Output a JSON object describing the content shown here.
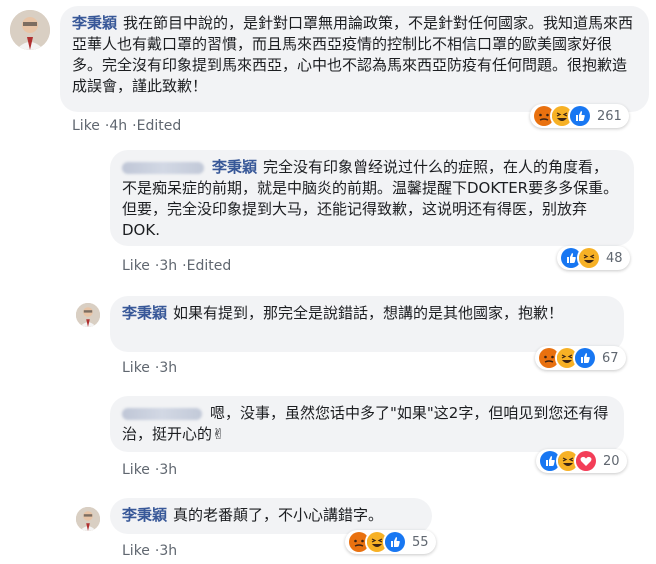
{
  "comments": [
    {
      "author": "李秉穎",
      "text": "我在節目中說的，是針對口罩無用論政策，不是針對任何國家。我知道馬來西亞華人也有戴口罩的習慣，而且馬來西亞疫情的控制比不相信口罩的歐美國家好很多。完全沒有印象提到馬來西亞，心中也不認為馬來西亞防疫有任何問題。很抱歉造成誤會，謹此致歉！",
      "like": "Like",
      "time": "4h",
      "edited": "Edited",
      "reactions": [
        "angry-icon",
        "haha-icon",
        "like-icon"
      ],
      "count": "261"
    },
    {
      "author": "李秉穎",
      "text": "完全没有印象曾经说过什么的症照，在人的角度看，不是痴呆症的前期，就是中脑炎的前期。温馨提醒下DOKTER要多多保重。但要，完全没印象提到大马，还能记得致歉，这说明还有得医，别放弃DOK.",
      "like": "Like",
      "time": "3h",
      "edited": "Edited",
      "reactions": [
        "like-icon",
        "haha-icon"
      ],
      "count": "48"
    },
    {
      "author": "李秉穎",
      "text": "如果有提到，那完全是說錯話，想講的是其他國家，抱歉！",
      "like": "Like",
      "time": "3h",
      "reactions": [
        "angry-icon",
        "haha-icon",
        "like-icon"
      ],
      "count": "67"
    },
    {
      "text": "嗯，没事，虽然您话中多了\"如果\"这2字，但咱见到您还有得治，挺开心的✌",
      "like": "Like",
      "time": "3h",
      "reactions": [
        "like-icon",
        "haha-icon",
        "love-icon"
      ],
      "count": "20"
    },
    {
      "author": "李秉穎",
      "text": "真的老番顛了，不小心講錯字。",
      "like": "Like",
      "time": "3h",
      "reactions": [
        "angry-icon",
        "haha-icon",
        "like-icon"
      ],
      "count": "55"
    }
  ],
  "colors": {
    "link": "#385898",
    "bubble": "#f2f3f5",
    "meta": "#606770",
    "like": "#1877f2",
    "love": "#f33e58",
    "emoji": "#f7b125",
    "angry": "#e9710f"
  }
}
